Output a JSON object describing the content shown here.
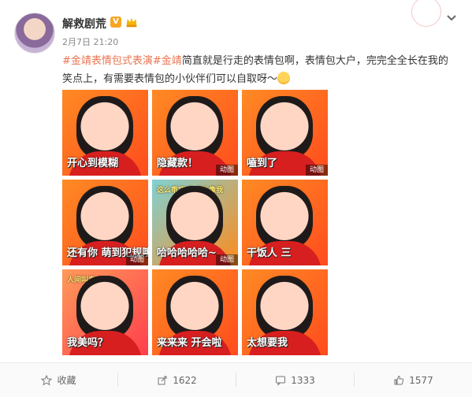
{
  "post": {
    "author": "解救剧荒",
    "badge": "V",
    "time": "2月7日 21:20",
    "hashtag1": "#金靖表情包式表演#",
    "hashtag2": "金靖",
    "text": "简直就是行走的表情包啊，表情包大户，完完全全长在我的笑点上，有需要表情包的小伙伴们可以自取呀～",
    "emoji": "smiling-face"
  },
  "images": [
    {
      "caption": "开心到模糊",
      "gif": ""
    },
    {
      "caption": "隐藏款！",
      "gif": "动图"
    },
    {
      "caption": "嗑到了",
      "gif": "动图"
    },
    {
      "caption": "还有你 萌到犯规哦",
      "gif": "动图"
    },
    {
      "caption": "哈哈哈哈哈~",
      "gif": "动图",
      "top": "这么乖巧 有点儿像我"
    },
    {
      "caption": "干饭人 三",
      "gif": ""
    },
    {
      "caption": "我美吗？",
      "gif": "",
      "top": "人间叫卖"
    },
    {
      "caption": "来来来 开会啦",
      "gif": ""
    },
    {
      "caption": "太想要我",
      "gif": ""
    }
  ],
  "footer": {
    "favorite": "收藏",
    "repost": "1622",
    "comments": "1333",
    "likes": "1577"
  },
  "colors": {
    "hashtag": "#eb7350",
    "tileOrange": "#ff6a1f"
  }
}
